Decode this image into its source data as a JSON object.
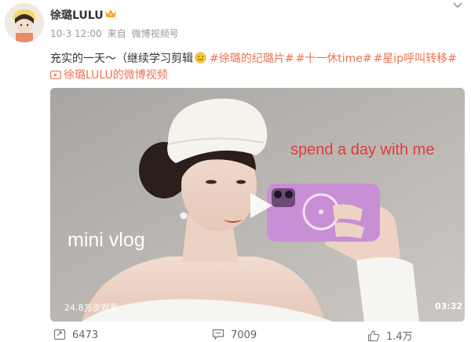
{
  "header": {
    "username": "徐璐LULU",
    "time": "10-3 12:00",
    "source_prefix": "来自",
    "source": "微博视频号"
  },
  "post": {
    "text_plain": "充实的一天～（继续学习剪辑",
    "tags": [
      "#徐璐的纪璐片#",
      "#十一休time#",
      "#星ip呼叫转移#"
    ],
    "video_link_label": "徐璐LULU的微博视频"
  },
  "video": {
    "overlay_caption_top": "spend a day with me",
    "overlay_caption_left": "mini vlog",
    "view_count": "24.8万次观看",
    "duration": "03:32"
  },
  "actions": {
    "repost_count": "6473",
    "comment_count": "7009",
    "like_count": "1.4万"
  },
  "colors": {
    "link_orange": "#eb7350",
    "caption_red": "#e23b3b",
    "crown_gold": "#f5a623"
  },
  "icons": [
    "crown-icon",
    "chevron-down-icon",
    "smile-emoji-icon",
    "video-camera-icon",
    "play-icon",
    "repost-icon",
    "comment-icon",
    "like-icon"
  ]
}
